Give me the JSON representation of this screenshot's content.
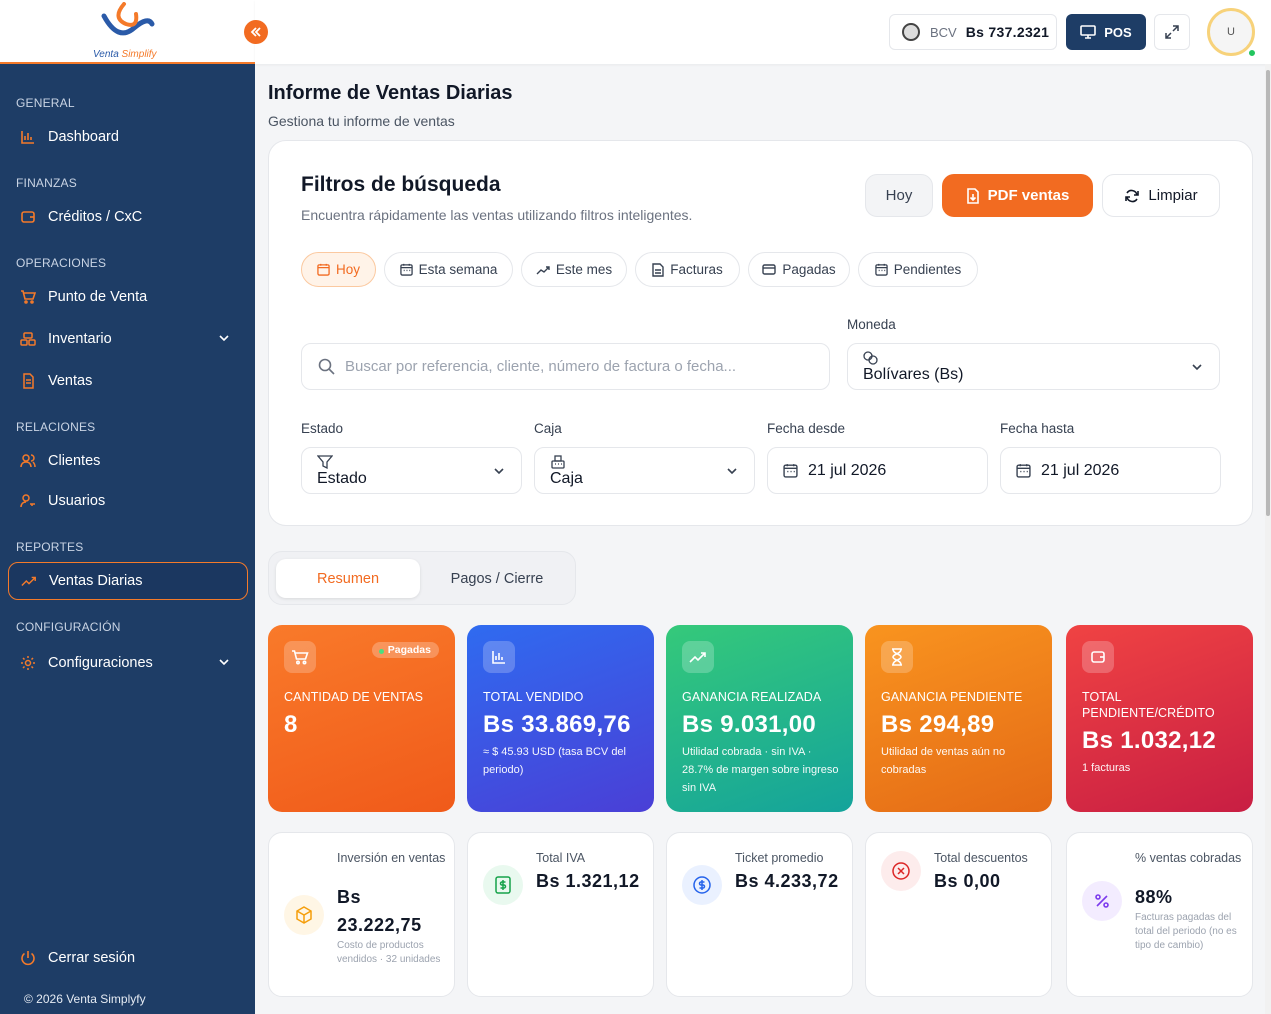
{
  "brand": {
    "name_prefix": "Venta",
    "name_suffix": " Simplify"
  },
  "sidebar": {
    "sections": [
      "GENERAL",
      "FINANZAS",
      "OPERACIONES",
      "RELACIONES",
      "REPORTES",
      "CONFIGURACIÓN"
    ],
    "items": [
      {
        "label": "Dashboard",
        "icon": "bar-chart-icon"
      },
      {
        "label": "Créditos / CxC",
        "icon": "wallet-icon"
      },
      {
        "label": "Punto de Venta",
        "icon": "cart-icon"
      },
      {
        "label": "Inventario",
        "icon": "boxes-icon"
      },
      {
        "label": "Ventas",
        "icon": "document-icon"
      },
      {
        "label": "Clientes",
        "icon": "users-icon"
      },
      {
        "label": "Usuarios",
        "icon": "user-key-icon"
      },
      {
        "label": "Ventas Diarias",
        "icon": "trending-icon",
        "active": true
      },
      {
        "label": "Configuraciones",
        "icon": "gear-icon"
      }
    ],
    "logout": "Cerrar sesión",
    "copyright": "© 2026 Venta Simplyfy"
  },
  "topbar": {
    "bcv_label": "BCV",
    "bcv_value": "Bs 737.2321",
    "pos_label": "POS",
    "avatar_initial": "U"
  },
  "page": {
    "title": "Informe de Ventas Diarias",
    "subtitle": "Gestiona tu informe de ventas"
  },
  "filters": {
    "title": "Filtros de búsqueda",
    "subtitle": "Encuentra rápidamente las ventas utilizando filtros inteligentes.",
    "btn_today": "Hoy",
    "btn_pdf": "PDF ventas",
    "btn_clear": "Limpiar",
    "chips": [
      "Hoy",
      "Esta semana",
      "Este mes",
      "Facturas",
      "Pagadas",
      "Pendientes"
    ],
    "search_placeholder": "Buscar por referencia, cliente, número de factura o fecha...",
    "currency_label": "Moneda",
    "currency_value": "Bolívares (Bs)",
    "status_label": "Estado",
    "status_value": "Estado",
    "register_label": "Caja",
    "register_value": "Caja",
    "date_from_label": "Fecha desde",
    "date_from_value": "21 jul 2026",
    "date_to_label": "Fecha hasta",
    "date_to_value": "21 jul 2026"
  },
  "tabs": {
    "summary": "Resumen",
    "payments": "Pagos / Cierre"
  },
  "stats": [
    {
      "label": "CANTIDAD DE VENTAS",
      "value": "8",
      "note": "",
      "badge": "Pagadas"
    },
    {
      "label": "TOTAL VENDIDO",
      "value": "Bs 33.869,76",
      "note": "≈ $ 45.93 USD (tasa BCV del periodo)"
    },
    {
      "label": "GANANCIA REALIZADA",
      "value": "Bs 9.031,00",
      "note": "Utilidad cobrada · sin IVA · 28.7% de margen sobre ingreso sin IVA"
    },
    {
      "label": "GANANCIA PENDIENTE",
      "value": "Bs 294,89",
      "note": "Utilidad de ventas aún no cobradas"
    },
    {
      "label": "TOTAL PENDIENTE/CRÉDITO",
      "value": "Bs 1.032,12",
      "note": "1 facturas"
    }
  ],
  "metrics": [
    {
      "label": "Inversión en ventas",
      "value": "Bs 23.222,75",
      "note": "Costo de productos vendidos · 32 unidades",
      "icon": "box-icon"
    },
    {
      "label": "Total IVA",
      "value": "Bs 1.321,12",
      "note": "",
      "icon": "receipt-dollar-icon"
    },
    {
      "label": "Ticket promedio",
      "value": "Bs 4.233,72",
      "note": "",
      "icon": "dollar-circle-icon"
    },
    {
      "label": "Total descuentos",
      "value": "Bs 0,00",
      "note": "",
      "icon": "x-circle-icon"
    },
    {
      "label": "% ventas cobradas",
      "value": "88%",
      "note": "Facturas pagadas del total del periodo (no es tipo de cambio)",
      "icon": "percent-icon"
    }
  ],
  "colors": {
    "accent": "#f26b21",
    "sidebar": "#1e3d66",
    "success": "#22c55e"
  }
}
